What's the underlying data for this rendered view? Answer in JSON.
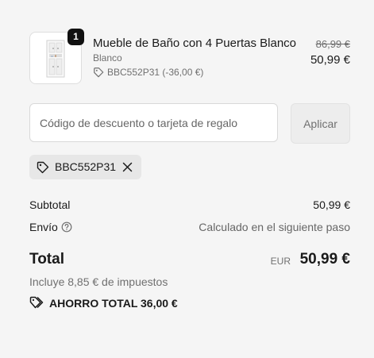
{
  "product": {
    "quantity": "1",
    "title": "Mueble de Baño con 4 Puertas Blanco",
    "variant": "Blanco",
    "discount_line": "BBC552P31 (-36,00 €)",
    "price_original": "86,99 €",
    "price_current": "50,99 €",
    "icons": {
      "tag": "tag-icon"
    }
  },
  "discount": {
    "placeholder": "Código de descuento o tarjeta de regalo",
    "value": "",
    "apply_label": "Aplicar",
    "applied_code": "BBC552P31",
    "icons": {
      "tag": "tag-icon",
      "remove": "close-icon"
    }
  },
  "summary": {
    "subtotal_label": "Subtotal",
    "subtotal_value": "50,99 €",
    "shipping_label": "Envío",
    "shipping_value": "Calculado en el siguiente paso",
    "total_label": "Total",
    "currency": "EUR",
    "total_value": "50,99 €",
    "tax_note": "Incluye 8,85 € de impuestos",
    "savings_label": "AHORRO TOTAL",
    "savings_value": "36,00 €",
    "icons": {
      "help": "question-circle-icon",
      "savings": "tags-icon"
    }
  },
  "colors": {
    "background": "#f5f5f5",
    "text": "#1a1a1a",
    "muted": "#707070",
    "badge": "#111111",
    "chip": "#e7e7e7"
  }
}
